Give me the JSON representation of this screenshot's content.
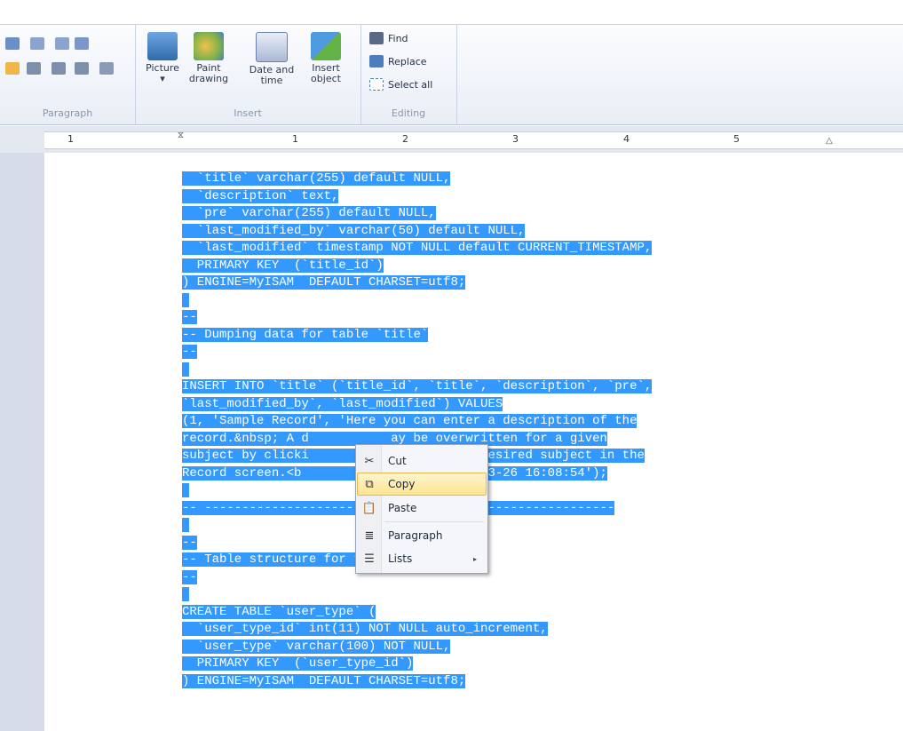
{
  "ribbon": {
    "groups": {
      "paragraph": {
        "label": "Paragraph"
      },
      "insert": {
        "label": "Insert",
        "tools": [
          {
            "label": "Picture",
            "sub": "▾"
          },
          {
            "label": "Paint",
            "sub": "drawing"
          },
          {
            "label": "Date and",
            "sub": "time"
          },
          {
            "label": "Insert",
            "sub": "object"
          }
        ]
      },
      "editing": {
        "label": "Editing",
        "items": [
          "Find",
          "Replace",
          "Select all"
        ]
      }
    }
  },
  "ruler": {
    "numbers": [
      "1",
      "1",
      "2",
      "3",
      "4",
      "5"
    ]
  },
  "document": {
    "lines": [
      "  `title` varchar(255) default NULL,",
      "  `description` text,",
      "  `pre` varchar(255) default NULL,",
      "  `last_modified_by` varchar(50) default NULL,",
      "  `last_modified` timestamp NOT NULL default CURRENT_TIMESTAMP,",
      "  PRIMARY KEY  (`title_id`)",
      ") ENGINE=MyISAM  DEFAULT CHARSET=utf8;",
      " ",
      "--",
      "-- Dumping data for table `title`",
      "--",
      " ",
      "INSERT INTO `title` (`title_id`, `title`, `description`, `pre`,",
      "`last_modified_by`, `last_modified`) VALUES",
      "(1, 'Sample Record', 'Here you can enter a description of the",
      "record.&nbsp; A d           ay be overwritten for a given",
      "subject by clicki           next to the desired subject in the",
      "Record screen.<b            NULL, '2011-03-26 16:08:54');",
      " ",
      "-- -------------------------------------------------------",
      " ",
      "--",
      "-- Table structure for table `user_type`",
      "--",
      " ",
      "CREATE TABLE `user_type` (",
      "  `user_type_id` int(11) NOT NULL auto_increment,",
      "  `user_type` varchar(100) NOT NULL,",
      "  PRIMARY KEY  (`user_type_id`)",
      ") ENGINE=MyISAM  DEFAULT CHARSET=utf8;"
    ]
  },
  "context_menu": {
    "items": [
      {
        "label": "Cut",
        "icon": "scissors-icon"
      },
      {
        "label": "Copy",
        "icon": "copy-icon",
        "highlighted": true
      },
      {
        "label": "Paste",
        "icon": "paste-icon"
      },
      {
        "label": "Paragraph",
        "icon": "paragraph-icon"
      },
      {
        "label": "Lists",
        "icon": "list-icon",
        "submenu": "▸"
      }
    ]
  },
  "colors": {
    "selection": "#3399ff",
    "menu_highlight": "#ffe48f",
    "ribbon_label": "#8a97ab"
  }
}
